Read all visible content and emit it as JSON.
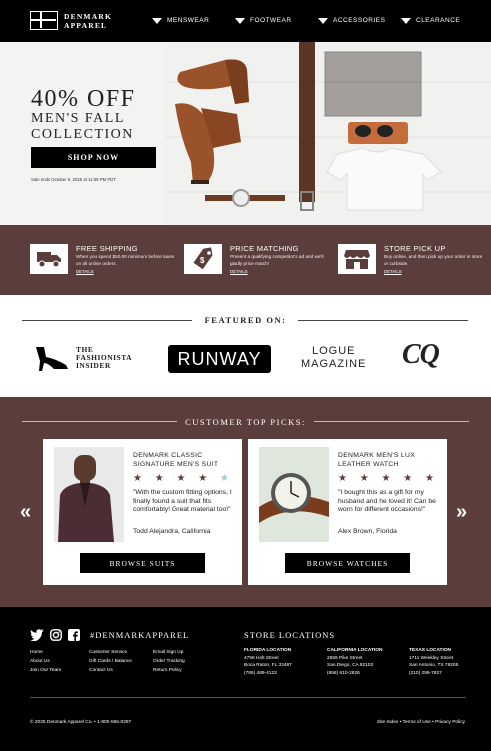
{
  "brand": {
    "line1": "DENMARK",
    "line2": "APPAREL"
  },
  "nav": [
    {
      "label": "MENSWEAR"
    },
    {
      "label": "FOOTWEAR"
    },
    {
      "label": "ACCESSORIES"
    },
    {
      "label": "CLEARANCE"
    }
  ],
  "hero": {
    "headline": "40% OFF",
    "subline1": "MEN'S FALL",
    "subline2": "COLLECTION",
    "cta": "SHOP NOW",
    "fine_print": "Sale ends October 6, 2025 at 11:59 PM PDT"
  },
  "features": [
    {
      "icon": "truck-icon",
      "title": "FREE SHIPPING",
      "desc": "When you spend $50.00 minimum before taxes on all online orders.",
      "link": "DETAILS"
    },
    {
      "icon": "price-tag-icon",
      "title": "PRICE MATCHING",
      "desc": "Present a qualifying competitor's ad and we'll gladly price match!",
      "link": "DETAILS"
    },
    {
      "icon": "storefront-icon",
      "title": "STORE PICK UP",
      "desc": "Buy online, and then pick up your order in store or curbside.",
      "link": "DETAILS"
    }
  ],
  "featured": {
    "heading": "FEATURED ON:",
    "logo1_line1": "THE",
    "logo1_line2": "FASHIONISTA",
    "logo1_line3": "INSIDER",
    "logo2": "RUNWAY",
    "logo3_line1": "LOGUE",
    "logo3_line2": "MAGAZINE",
    "logo4": "CQ"
  },
  "picks": {
    "heading": "CUSTOMER TOP PICKS:",
    "items": [
      {
        "name": "DENMARK CLASSIC SIGNATURE MEN'S SUIT",
        "rating": 4,
        "max_rating": 5,
        "stars": "★ ★ ★ ★",
        "empty_star": "★",
        "quote": "\"With the custom fitting options, I finally found a suit that fits comfortably! Great material too!\"",
        "author": "Todd Alejandra, California",
        "cta": "BROWSE SUITS"
      },
      {
        "name": "DENMARK MEN'S LUX LEATHER WATCH",
        "rating": 5,
        "max_rating": 5,
        "stars": "★ ★ ★ ★ ★",
        "quote": "\"I bought this as a gift for my husband and he loved it! Can be worn for different occasions!\"",
        "author": "Alex Brown, Florida",
        "cta": "BROWSE WATCHES"
      }
    ],
    "prev": "«",
    "next": "»"
  },
  "footer": {
    "hashtag": "#DENMARKAPPAREL",
    "col1": [
      "Home",
      "About Us",
      "Join Our Team"
    ],
    "col2": [
      "Customer Service",
      "Gift Cards / Balance",
      "Contact Us"
    ],
    "col3": [
      "Email Sign Up",
      "Order Tracking",
      "Return Policy"
    ],
    "stores_heading": "STORE LOCATIONS",
    "stores": [
      {
        "name": "FLORIDA LOCATION",
        "street": "4758 Holt Street",
        "city": "Boca Raton, FL 33487",
        "phone": "(785) 489-4123"
      },
      {
        "name": "CALIFORNIA LOCATION",
        "street": "2659 Pike Street",
        "city": "San Diego, CA 92103",
        "phone": "(858) 610-2826"
      },
      {
        "name": "TEXAS LOCATION",
        "street": "1711 Weekley Street",
        "city": "San Antonio, TX 78205",
        "phone": "(210) 299-7827"
      }
    ],
    "copyright": "© 2025 Denmark Apparel Co. • 1-800-555-0287",
    "legal": "Site Index • Terms of Use • Privacy Policy"
  },
  "colors": {
    "brown": "#5b3d3c",
    "black": "#000000",
    "star": "#5b3d3c",
    "star_empty": "#9ec9c9"
  }
}
